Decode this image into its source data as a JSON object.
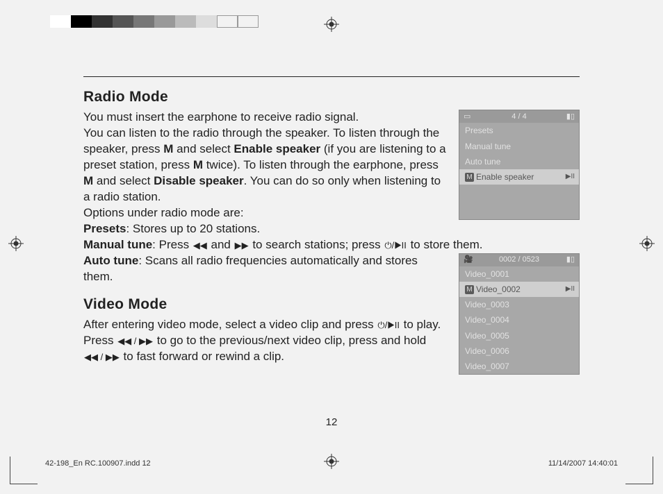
{
  "calibration": {
    "left_swatches": [
      "#ffffff",
      "#000000",
      "#333333",
      "#555555",
      "#777777",
      "#999999",
      "#bbbbbb",
      "#dddddd"
    ],
    "right_swatches": [
      "#f7e600",
      "#ff00ff",
      "#00aee6",
      "#8a8a8a",
      "#c00000",
      "#009900",
      "#000099",
      "#ff66cc",
      "#00ffff"
    ]
  },
  "radio": {
    "heading": "Radio Mode",
    "p1a": "You must insert the earphone to receive radio signal.",
    "p1b": "You can listen to the radio through the speaker. To listen through the speaker, press ",
    "p1c": " and select ",
    "p1d": " (if you are listening to a preset station, press ",
    "p1e": " twice). To listen through the earphone, press ",
    "p1f": " and select ",
    "p1g": ". You can do so only when listening to a radio station.",
    "m": "M",
    "enable_speaker": "Enable speaker",
    "disable_speaker": "Disable speaker",
    "options_intro": "Options under radio mode are:",
    "presets_label": "Presets",
    "presets_desc": ": Stores up to 20 stations.",
    "manual_label": "Manual tune",
    "manual_a": ": Press ",
    "manual_b": " and ",
    "manual_c": " to search stations; press ",
    "manual_d": " to store them.",
    "auto_label": "Auto tune",
    "auto_desc": ": Scans all radio frequencies automatically and stores them."
  },
  "video": {
    "heading": "Video Mode",
    "a": "After entering video mode, select a video clip and press ",
    "b": " to play. Press ",
    "c": " to go to the previous/next video clip, press and hold ",
    "d": " to fast forward or rewind a clip."
  },
  "radio_screen": {
    "counter": "4 / 4",
    "items": [
      "Presets",
      "Manual tune",
      "Auto tune"
    ],
    "selected": "Enable speaker",
    "selected_badge": "M",
    "selected_ind": "▶II"
  },
  "video_screen": {
    "counter": "0002 / 0523",
    "items_before": [
      "Video_0001"
    ],
    "selected": "Video_0002",
    "selected_badge": "M",
    "selected_ind": "▶II",
    "items_after": [
      "Video_0003",
      "Video_0004",
      "Video_0005",
      "Video_0006",
      "Video_0007"
    ]
  },
  "icons": {
    "rew": "◀◀",
    "fwd": "▶▶",
    "rewfwd": "◀◀ / ▶▶",
    "power_play": "⏻/▶II"
  },
  "page_number": "12",
  "footer": {
    "file": "42-198_En RC.100907.indd   12",
    "datetime": "11/14/2007   14:40:01"
  }
}
